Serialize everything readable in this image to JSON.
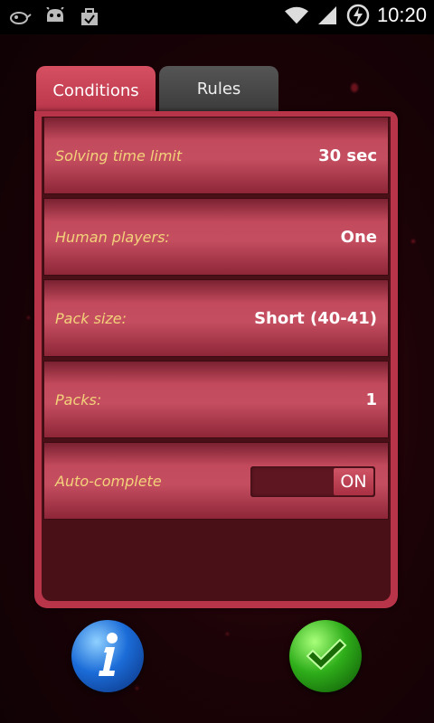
{
  "status_bar": {
    "time": "10:20",
    "icons": [
      "lizard-icon",
      "android-icon",
      "briefcase-icon",
      "wifi-icon",
      "signal-icon",
      "battery-charging-icon"
    ]
  },
  "tabs": [
    {
      "label": "Conditions",
      "active": true
    },
    {
      "label": "Rules",
      "active": false
    }
  ],
  "settings": {
    "rows": [
      {
        "label": "Solving time limit",
        "value": "30 sec"
      },
      {
        "label": "Human players:",
        "value": "One"
      },
      {
        "label": "Pack size:",
        "value": "Short (40-41)"
      },
      {
        "label": "Packs:",
        "value": "1"
      }
    ],
    "auto_complete": {
      "label": "Auto-complete",
      "state": "ON"
    }
  },
  "buttons": {
    "info": "info-icon",
    "confirm": "checkmark-icon"
  },
  "colors": {
    "accent": "#b83448",
    "label_text": "#f3d27a"
  }
}
